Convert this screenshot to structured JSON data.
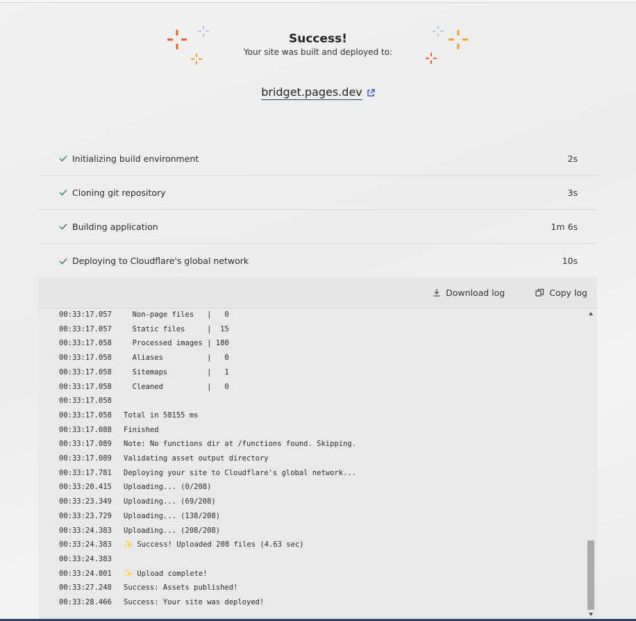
{
  "hero": {
    "title": "Success!",
    "subtitle": "Your site was built and deployed to:",
    "site_url": "bridget.pages.dev"
  },
  "colors": {
    "accent_orange": "#e8612c",
    "accent_amber": "#f0a030",
    "accent_lavender": "#b9c1e6",
    "check_green": "#3f7d5c"
  },
  "steps": [
    {
      "label": "Initializing build environment",
      "duration": "2s"
    },
    {
      "label": "Cloning git repository",
      "duration": "3s"
    },
    {
      "label": "Building application",
      "duration": "1m 6s"
    },
    {
      "label": "Deploying to Cloudflare's global network",
      "duration": "10s"
    }
  ],
  "log_toolbar": {
    "download_label": "Download log",
    "copy_label": "Copy log"
  },
  "log_lines": [
    {
      "ts": "00:33:17.057",
      "msg": "  Non-page files   |   0"
    },
    {
      "ts": "00:33:17.057",
      "msg": "  Static files     |  15"
    },
    {
      "ts": "00:33:17.058",
      "msg": "  Processed images | 180"
    },
    {
      "ts": "00:33:17.058",
      "msg": "  Aliases          |   0"
    },
    {
      "ts": "00:33:17.058",
      "msg": "  Sitemaps         |   1"
    },
    {
      "ts": "00:33:17.058",
      "msg": "  Cleaned          |   0"
    },
    {
      "ts": "00:33:17.058",
      "msg": ""
    },
    {
      "ts": "00:33:17.058",
      "msg": "Total in 58155 ms"
    },
    {
      "ts": "00:33:17.088",
      "msg": "Finished"
    },
    {
      "ts": "00:33:17.089",
      "msg": "Note: No functions dir at /functions found. Skipping."
    },
    {
      "ts": "00:33:17.089",
      "msg": "Validating asset output directory"
    },
    {
      "ts": "00:33:17.781",
      "msg": "Deploying your site to Cloudflare's global network..."
    },
    {
      "ts": "00:33:20.415",
      "msg": "Uploading... (0/208)"
    },
    {
      "ts": "00:33:23.349",
      "msg": "Uploading... (69/208)"
    },
    {
      "ts": "00:33:23.729",
      "msg": "Uploading... (138/208)"
    },
    {
      "ts": "00:33:24.383",
      "msg": "Uploading... (208/208)"
    },
    {
      "ts": "00:33:24.383",
      "msg": "✨ Success! Uploaded 208 files (4.63 sec)"
    },
    {
      "ts": "00:33:24.383",
      "msg": ""
    },
    {
      "ts": "00:33:24.801",
      "msg": "✨ Upload complete!"
    },
    {
      "ts": "00:33:27.248",
      "msg": "Success: Assets published!"
    },
    {
      "ts": "00:33:28.466",
      "msg": "Success: Your site was deployed!"
    }
  ]
}
